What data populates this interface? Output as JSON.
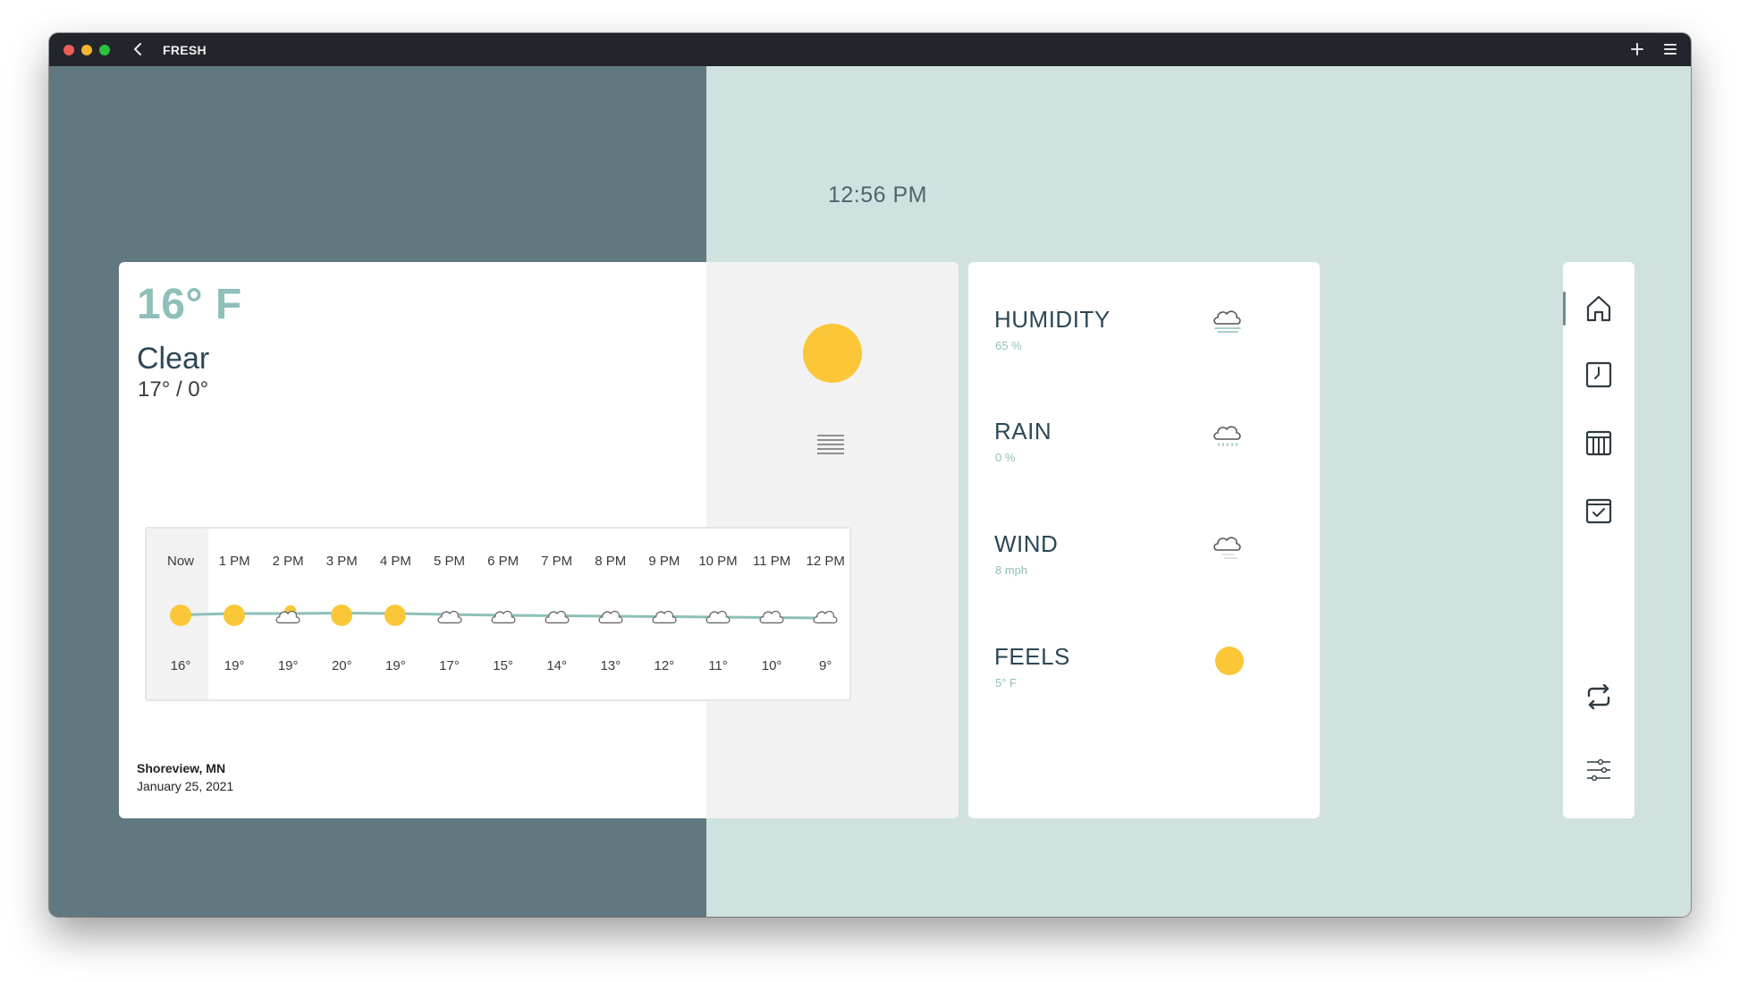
{
  "titlebar": {
    "app_title": "FRESH",
    "icons": [
      "close-dot",
      "minimize-dot",
      "maximize-dot",
      "back-icon",
      "plus-icon",
      "menu-icon"
    ]
  },
  "clock": "12:56 PM",
  "current": {
    "temperature": "16° F",
    "condition": "Clear",
    "high_low": "17° / 0°",
    "condition_icon": "sun-icon",
    "secondary_icon": "fog-lines-icon"
  },
  "forecast": {
    "hours": [
      {
        "label": "Now",
        "temp": "16°",
        "icon": "sun"
      },
      {
        "label": "1 PM",
        "temp": "19°",
        "icon": "sun"
      },
      {
        "label": "2 PM",
        "temp": "19°",
        "icon": "cloud-sun"
      },
      {
        "label": "3 PM",
        "temp": "20°",
        "icon": "sun"
      },
      {
        "label": "4 PM",
        "temp": "19°",
        "icon": "sun"
      },
      {
        "label": "5 PM",
        "temp": "17°",
        "icon": "cloud"
      },
      {
        "label": "6 PM",
        "temp": "15°",
        "icon": "cloud"
      },
      {
        "label": "7 PM",
        "temp": "14°",
        "icon": "cloud"
      },
      {
        "label": "8 PM",
        "temp": "13°",
        "icon": "cloud"
      },
      {
        "label": "9 PM",
        "temp": "12°",
        "icon": "cloud"
      },
      {
        "label": "10 PM",
        "temp": "11°",
        "icon": "cloud"
      },
      {
        "label": "11 PM",
        "temp": "10°",
        "icon": "cloud"
      },
      {
        "label": "12 PM",
        "temp": "9°",
        "icon": "cloud"
      }
    ]
  },
  "location": {
    "place": "Shoreview, MN",
    "date": "January 25, 2021"
  },
  "metrics": [
    {
      "name": "HUMIDITY",
      "value": "65 %",
      "icon": "cloud-fog-icon"
    },
    {
      "name": "RAIN",
      "value": "0 %",
      "icon": "cloud-rain-icon"
    },
    {
      "name": "WIND",
      "value": "8 mph",
      "icon": "cloud-wind-icon"
    },
    {
      "name": "FEELS",
      "value": "5° F",
      "icon": "sun-icon"
    }
  ],
  "nav": {
    "items": [
      "home-icon",
      "clock-icon",
      "calendar-icon",
      "checklist-icon",
      "refresh-icon",
      "settings-sliders-icon"
    ],
    "active": "home-icon"
  },
  "colors": {
    "left_background": "#627880",
    "right_background": "#cfe2e0",
    "accent": "#8ebfba",
    "sun": "#fbc738",
    "text_dark": "#2e4757",
    "titlebar": "#22262c"
  }
}
